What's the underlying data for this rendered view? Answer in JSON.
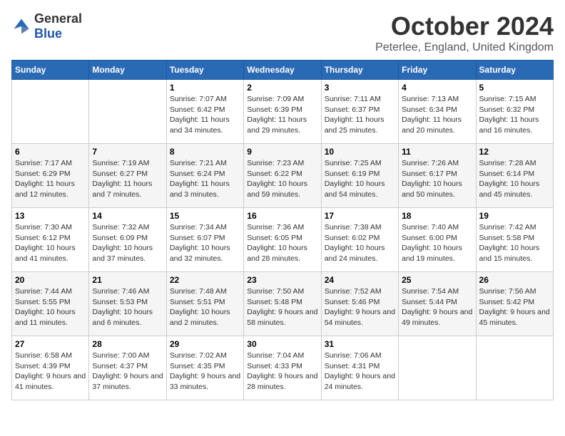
{
  "logo": {
    "general": "General",
    "blue": "Blue"
  },
  "header": {
    "month": "October 2024",
    "location": "Peterlee, England, United Kingdom"
  },
  "days": [
    "Sunday",
    "Monday",
    "Tuesday",
    "Wednesday",
    "Thursday",
    "Friday",
    "Saturday"
  ],
  "weeks": [
    [
      {
        "day": "",
        "content": ""
      },
      {
        "day": "",
        "content": ""
      },
      {
        "day": "1",
        "content": "Sunrise: 7:07 AM\nSunset: 6:42 PM\nDaylight: 11 hours and 34 minutes."
      },
      {
        "day": "2",
        "content": "Sunrise: 7:09 AM\nSunset: 6:39 PM\nDaylight: 11 hours and 29 minutes."
      },
      {
        "day": "3",
        "content": "Sunrise: 7:11 AM\nSunset: 6:37 PM\nDaylight: 11 hours and 25 minutes."
      },
      {
        "day": "4",
        "content": "Sunrise: 7:13 AM\nSunset: 6:34 PM\nDaylight: 11 hours and 20 minutes."
      },
      {
        "day": "5",
        "content": "Sunrise: 7:15 AM\nSunset: 6:32 PM\nDaylight: 11 hours and 16 minutes."
      }
    ],
    [
      {
        "day": "6",
        "content": "Sunrise: 7:17 AM\nSunset: 6:29 PM\nDaylight: 11 hours and 12 minutes."
      },
      {
        "day": "7",
        "content": "Sunrise: 7:19 AM\nSunset: 6:27 PM\nDaylight: 11 hours and 7 minutes."
      },
      {
        "day": "8",
        "content": "Sunrise: 7:21 AM\nSunset: 6:24 PM\nDaylight: 11 hours and 3 minutes."
      },
      {
        "day": "9",
        "content": "Sunrise: 7:23 AM\nSunset: 6:22 PM\nDaylight: 10 hours and 59 minutes."
      },
      {
        "day": "10",
        "content": "Sunrise: 7:25 AM\nSunset: 6:19 PM\nDaylight: 10 hours and 54 minutes."
      },
      {
        "day": "11",
        "content": "Sunrise: 7:26 AM\nSunset: 6:17 PM\nDaylight: 10 hours and 50 minutes."
      },
      {
        "day": "12",
        "content": "Sunrise: 7:28 AM\nSunset: 6:14 PM\nDaylight: 10 hours and 45 minutes."
      }
    ],
    [
      {
        "day": "13",
        "content": "Sunrise: 7:30 AM\nSunset: 6:12 PM\nDaylight: 10 hours and 41 minutes."
      },
      {
        "day": "14",
        "content": "Sunrise: 7:32 AM\nSunset: 6:09 PM\nDaylight: 10 hours and 37 minutes."
      },
      {
        "day": "15",
        "content": "Sunrise: 7:34 AM\nSunset: 6:07 PM\nDaylight: 10 hours and 32 minutes."
      },
      {
        "day": "16",
        "content": "Sunrise: 7:36 AM\nSunset: 6:05 PM\nDaylight: 10 hours and 28 minutes."
      },
      {
        "day": "17",
        "content": "Sunrise: 7:38 AM\nSunset: 6:02 PM\nDaylight: 10 hours and 24 minutes."
      },
      {
        "day": "18",
        "content": "Sunrise: 7:40 AM\nSunset: 6:00 PM\nDaylight: 10 hours and 19 minutes."
      },
      {
        "day": "19",
        "content": "Sunrise: 7:42 AM\nSunset: 5:58 PM\nDaylight: 10 hours and 15 minutes."
      }
    ],
    [
      {
        "day": "20",
        "content": "Sunrise: 7:44 AM\nSunset: 5:55 PM\nDaylight: 10 hours and 11 minutes."
      },
      {
        "day": "21",
        "content": "Sunrise: 7:46 AM\nSunset: 5:53 PM\nDaylight: 10 hours and 6 minutes."
      },
      {
        "day": "22",
        "content": "Sunrise: 7:48 AM\nSunset: 5:51 PM\nDaylight: 10 hours and 2 minutes."
      },
      {
        "day": "23",
        "content": "Sunrise: 7:50 AM\nSunset: 5:48 PM\nDaylight: 9 hours and 58 minutes."
      },
      {
        "day": "24",
        "content": "Sunrise: 7:52 AM\nSunset: 5:46 PM\nDaylight: 9 hours and 54 minutes."
      },
      {
        "day": "25",
        "content": "Sunrise: 7:54 AM\nSunset: 5:44 PM\nDaylight: 9 hours and 49 minutes."
      },
      {
        "day": "26",
        "content": "Sunrise: 7:56 AM\nSunset: 5:42 PM\nDaylight: 9 hours and 45 minutes."
      }
    ],
    [
      {
        "day": "27",
        "content": "Sunrise: 6:58 AM\nSunset: 4:39 PM\nDaylight: 9 hours and 41 minutes."
      },
      {
        "day": "28",
        "content": "Sunrise: 7:00 AM\nSunset: 4:37 PM\nDaylight: 9 hours and 37 minutes."
      },
      {
        "day": "29",
        "content": "Sunrise: 7:02 AM\nSunset: 4:35 PM\nDaylight: 9 hours and 33 minutes."
      },
      {
        "day": "30",
        "content": "Sunrise: 7:04 AM\nSunset: 4:33 PM\nDaylight: 9 hours and 28 minutes."
      },
      {
        "day": "31",
        "content": "Sunrise: 7:06 AM\nSunset: 4:31 PM\nDaylight: 9 hours and 24 minutes."
      },
      {
        "day": "",
        "content": ""
      },
      {
        "day": "",
        "content": ""
      }
    ]
  ]
}
